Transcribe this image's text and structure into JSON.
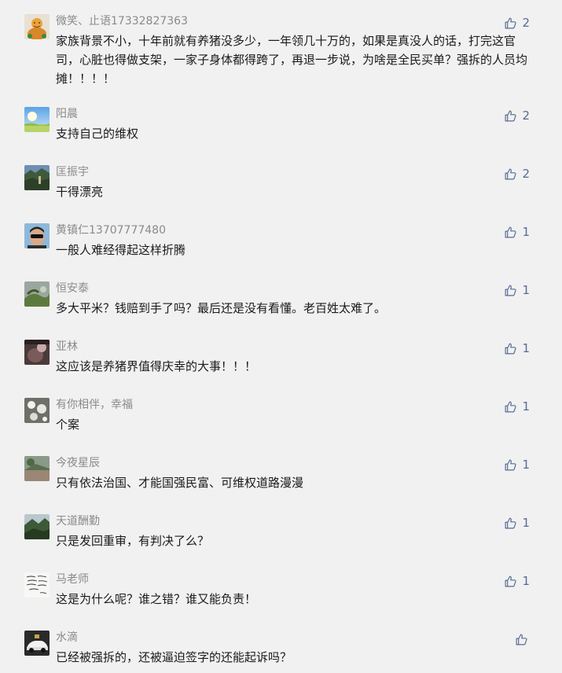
{
  "comments": [
    {
      "name": "微笑、止语17332827363",
      "text": "家族背景不小，十年前就有养猪没多少，一年领几十万的，如果是真没人的话，打完这官司，心脏也得做支架，一家子身体都得跨了，再退一步说，为啥是全民买单？强拆的人员均摊！！！！",
      "likes": "2"
    },
    {
      "name": "阳晨",
      "text": "支持自己的维权",
      "likes": "2"
    },
    {
      "name": "匡振宇",
      "text": "干得漂亮",
      "likes": "2"
    },
    {
      "name": "黄镇仁13707777480",
      "text": "一般人难经得起这样折腾",
      "likes": "1"
    },
    {
      "name": "恒安泰",
      "text": "多大平米？钱赔到手了吗？最后还是没有看懂。老百姓太难了。",
      "likes": "1"
    },
    {
      "name": "亚林",
      "text": "这应该是养猪界值得庆幸的大事！！！",
      "likes": "1"
    },
    {
      "name": "有你相伴，幸福",
      "text": "个案",
      "likes": "1"
    },
    {
      "name": "今夜星辰",
      "text": "只有依法治国、才能国强民富、可维权道路漫漫",
      "likes": "1"
    },
    {
      "name": "天道酬勤",
      "text": "只是发回重审，有判决了么？",
      "likes": "1"
    },
    {
      "name": "马老师",
      "text": "这是为什么呢？谁之错？谁又能负责！",
      "likes": "1"
    },
    {
      "name": "水滴",
      "text": "已经被强拆的，还被逼迫签字的还能起诉吗？",
      "likes": ""
    }
  ],
  "colors": {
    "background": "#f1f1f1",
    "name": "#8a8a8a",
    "text": "#1a1a1a",
    "like": "#576b95"
  },
  "icons": {
    "like": "thumbs-up-icon"
  }
}
